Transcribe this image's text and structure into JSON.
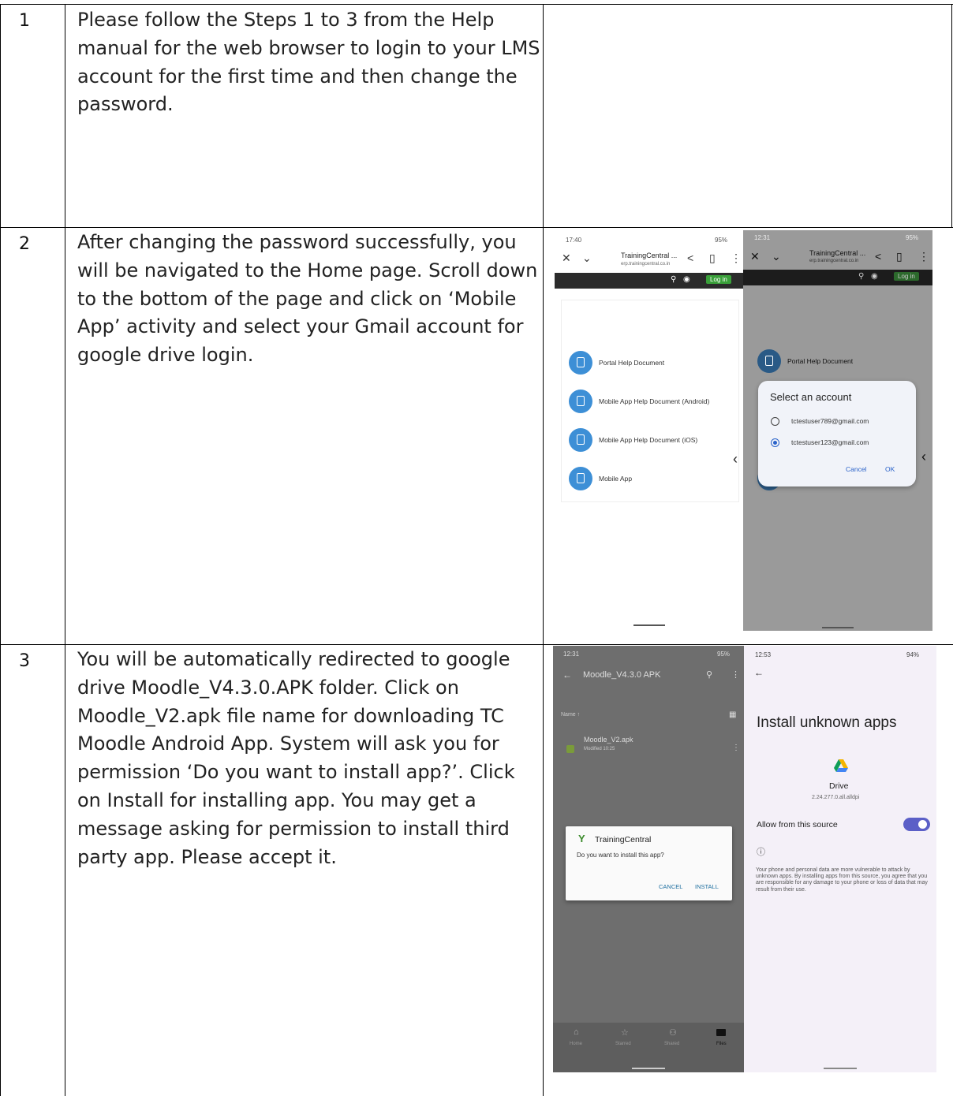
{
  "rows": [
    {
      "number": "1",
      "text": "Please follow the Steps 1 to 3 from the Help manual for the web browser to login to your LMS account for the first time and then change the password."
    },
    {
      "number": "2",
      "text": "After changing the password successfully, you will be navigated to the Home page. Scroll down to the bottom of the page and click on ‘Mobile App’ activity and select your Gmail account for google drive login."
    },
    {
      "number": "3",
      "text": "You will be automatically redirected to google drive Moodle_V4.3.0.APK folder. Click on Moodle_V2.apk file name for downloading TC Moodle Android App. System will ask you for permission ‘Do you want to install app?’. Click on Install for installing app. You may get a message asking for permission to install third party app. Please accept it."
    }
  ],
  "shot_portal": {
    "time": "17:40",
    "status_right": "95%",
    "site_title": "TrainingCentral ...",
    "site_url": "erp.trainingcentral.co.in",
    "login_label": "Log in",
    "items": [
      "Portal Help Document",
      "Mobile App Help Document (Android)",
      "Mobile App Help Document (iOS)",
      "Mobile App"
    ]
  },
  "shot_account": {
    "time": "12:31",
    "status_right": "95%",
    "site_title": "TrainingCentral ...",
    "site_url": "erp.trainingcentral.co.in",
    "login_label": "Log in",
    "portal_item": "Portal Help Document",
    "dialog_title": "Select an account",
    "accounts": [
      "tctestuser789@gmail.com",
      "tctestuser123@gmail.com"
    ],
    "cancel": "Cancel",
    "ok": "OK"
  },
  "shot_drive": {
    "time": "12:31",
    "status_right": "95%",
    "folder": "Moodle_V4.3.0 APK",
    "sort_label": "Name ↑",
    "file_name": "Moodle_V2.apk",
    "file_meta": "Modified 10:25",
    "dialog_app": "TrainingCentral",
    "dialog_question": "Do you want to install this app?",
    "cancel": "CANCEL",
    "install": "INSTALL",
    "nav": [
      "Home",
      "Starred",
      "Shared",
      "Files"
    ]
  },
  "shot_unknown": {
    "time": "12:53",
    "status_right": "94%",
    "title": "Install unknown apps",
    "app_name": "Drive",
    "app_version": "2.24.277.0.all.alldpi",
    "allow_label": "Allow from this source",
    "toggle_on": true,
    "warning": "Your phone and personal data are more vulnerable to attack by unknown apps. By installing apps from this source, you agree that you are responsible for any damage to your phone or loss of data that may result from their use.",
    "colors": {
      "toggle": "#5b5fc7",
      "background": "#f4f0f8"
    }
  }
}
